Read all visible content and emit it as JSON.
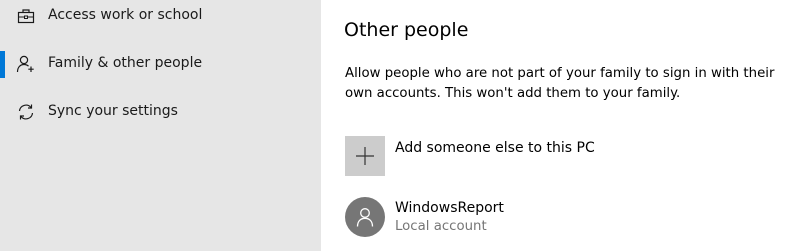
{
  "sidebar": {
    "items": [
      {
        "label": "Access work or school",
        "icon": "briefcase-icon",
        "selected": false
      },
      {
        "label": "Family & other people",
        "icon": "add-person-icon",
        "selected": true
      },
      {
        "label": "Sync your settings",
        "icon": "sync-icon",
        "selected": false
      }
    ]
  },
  "main": {
    "title": "Other people",
    "description": "Allow people who are not part of your family to sign in with their own accounts. This won't add them to your family.",
    "add_button": {
      "label": "Add someone else to this PC",
      "icon": "plus-icon"
    },
    "accounts": [
      {
        "name": "WindowsReport",
        "type": "Local account",
        "icon": "user-avatar-icon"
      }
    ]
  },
  "colors": {
    "sidebar_background": "#e6e6e6",
    "selection_accent": "#0078d7",
    "add_tile": "#cccccc",
    "avatar_background": "#767676",
    "secondary_text": "#767676"
  }
}
